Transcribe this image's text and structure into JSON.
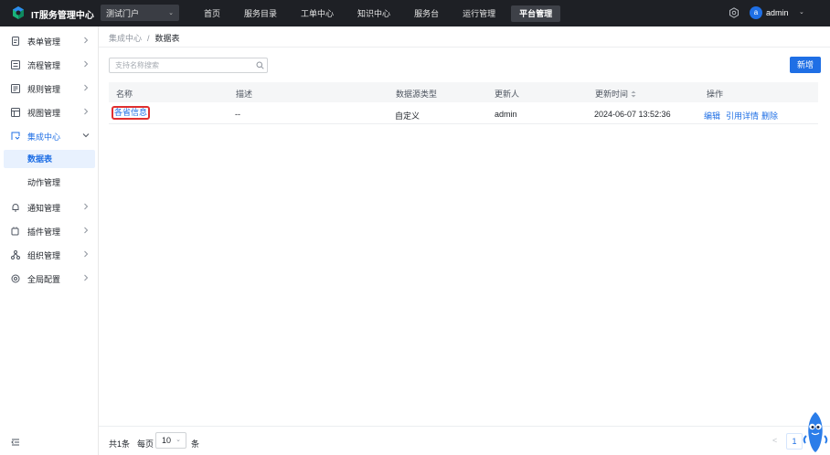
{
  "header": {
    "app_title": "IT服务管理中心",
    "portal_selected": "测试门户",
    "nav": [
      "首页",
      "服务目录",
      "工单中心",
      "知识中心",
      "服务台",
      "运行管理",
      "平台管理"
    ],
    "active_nav": "平台管理",
    "user_initial": "a",
    "user_name": "admin"
  },
  "sidebar": {
    "items": [
      {
        "label": "表单管理",
        "icon": "form-icon"
      },
      {
        "label": "流程管理",
        "icon": "flow-icon"
      },
      {
        "label": "规则管理",
        "icon": "rule-icon"
      },
      {
        "label": "视图管理",
        "icon": "view-icon"
      },
      {
        "label": "集成中心",
        "icon": "integration-icon"
      },
      {
        "label": "通知管理",
        "icon": "bell-icon"
      },
      {
        "label": "插件管理",
        "icon": "plugin-icon"
      },
      {
        "label": "组织管理",
        "icon": "org-icon"
      },
      {
        "label": "全局配置",
        "icon": "gear-icon"
      }
    ],
    "sub_items": [
      "数据表",
      "动作管理"
    ]
  },
  "breadcrumb": {
    "parent": "集成中心",
    "separator": "/",
    "current": "数据表"
  },
  "search": {
    "placeholder": "支持名称搜索"
  },
  "toolbar": {
    "new_label": "新增"
  },
  "table": {
    "headers": [
      "名称",
      "描述",
      "数据源类型",
      "更新人",
      "更新时间",
      "操作"
    ],
    "rows": [
      {
        "name": "各省信息",
        "description": "--",
        "source_type": "自定义",
        "updated_by": "admin",
        "updated_at": "2024-06-07 13:52:36",
        "actions": [
          "编辑",
          "引用详情",
          "删除"
        ]
      }
    ]
  },
  "pagination": {
    "total": "共1条",
    "per_page_label": "每页",
    "page_size": "10",
    "unit": "条",
    "prev": "<",
    "current_page": "1"
  },
  "colors": {
    "primary": "#1f6fe5",
    "topbar": "#1e2025",
    "highlight_border": "#e02f2f"
  }
}
